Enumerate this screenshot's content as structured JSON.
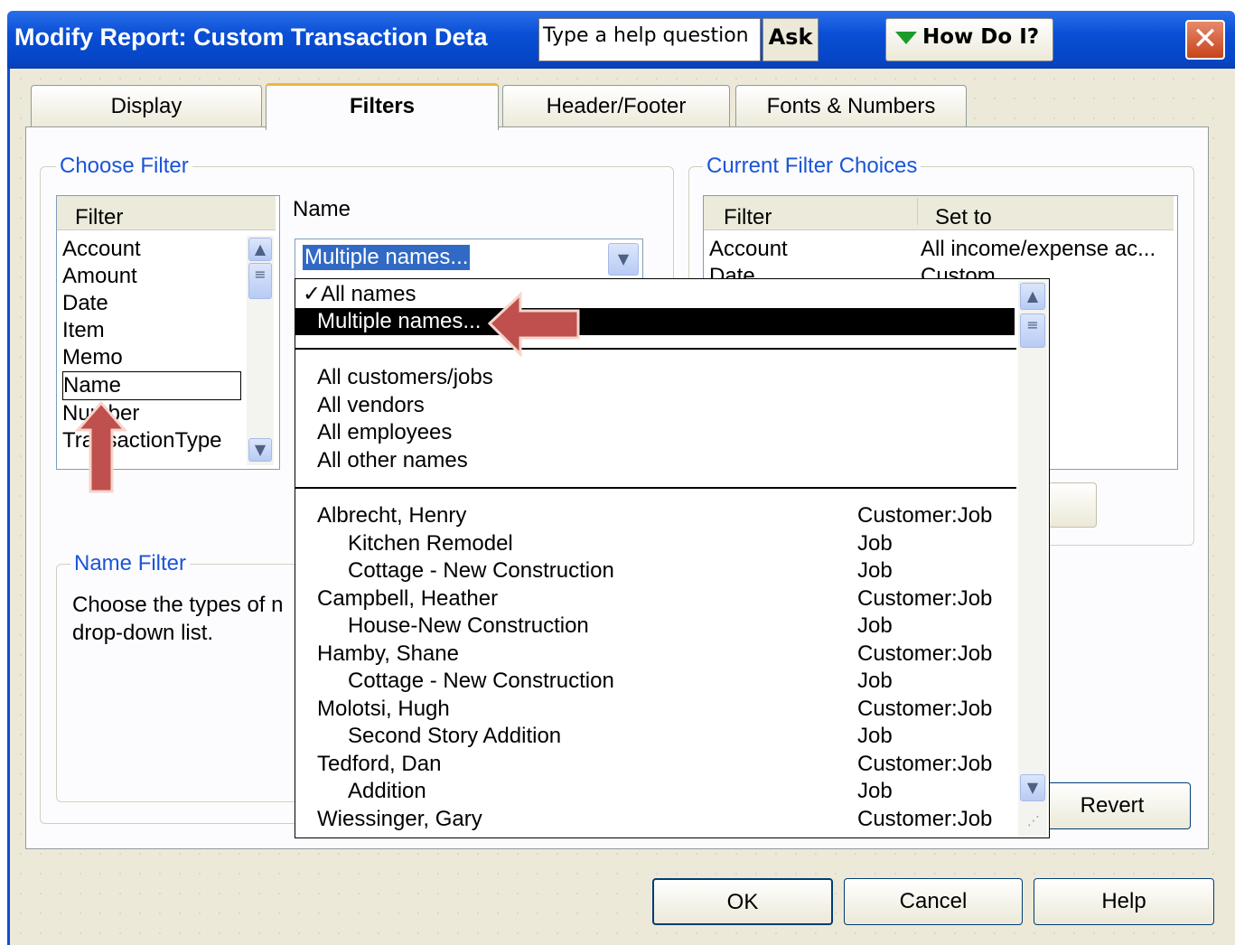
{
  "window": {
    "title": "Modify Report: Custom Transaction Deta",
    "help_placeholder": "Type a help question",
    "ask_label": "Ask",
    "how_do_i_label": "How Do I?",
    "close_glyph": "✕"
  },
  "tabs": [
    {
      "label": "Display",
      "active": false
    },
    {
      "label": "Filters",
      "active": true
    },
    {
      "label": "Header/Footer",
      "active": false
    },
    {
      "label": "Fonts & Numbers",
      "active": false
    }
  ],
  "choose_filter": {
    "title": "Choose Filter",
    "list_header": "Filter",
    "items": [
      "Account",
      "Amount",
      "Date",
      "Item",
      "Memo",
      "Name",
      "Number",
      "TransactionType"
    ],
    "selected": "Name",
    "field_label": "Name",
    "combo_value": "Multiple names..."
  },
  "current_filters": {
    "title": "Current Filter Choices",
    "col_filter": "Filter",
    "col_set_to": "Set to",
    "rows": [
      {
        "filter": "Account",
        "set_to": "All income/expense ac..."
      },
      {
        "filter": "Date",
        "set_to": "Custom"
      }
    ]
  },
  "name_filter": {
    "title": "Name Filter",
    "text_line1": "Choose the types of n",
    "text_line2": "drop-down list."
  },
  "dropdown": {
    "top_items": [
      {
        "label": "All names",
        "checked": true,
        "check_glyph": "✓"
      },
      {
        "label": "Multiple names...",
        "highlighted": true
      }
    ],
    "groups": [
      "All customers/jobs",
      "All vendors",
      "All employees",
      "All other names"
    ],
    "names": [
      {
        "name": "Albrecht, Henry",
        "type": "Customer:Job"
      },
      {
        "name": "Kitchen Remodel",
        "type": "Job"
      },
      {
        "name": "Cottage - New Construction",
        "type": "Job"
      },
      {
        "name": "Campbell, Heather",
        "type": "Customer:Job"
      },
      {
        "name": "House-New Construction",
        "type": "Job"
      },
      {
        "name": "Hamby, Shane",
        "type": "Customer:Job"
      },
      {
        "name": "Cottage - New Construction",
        "type": "Job"
      },
      {
        "name": "Molotsi, Hugh",
        "type": "Customer:Job"
      },
      {
        "name": "Second Story Addition",
        "type": "Job"
      },
      {
        "name": "Tedford, Dan",
        "type": "Customer:Job"
      },
      {
        "name": "Addition",
        "type": "Job"
      },
      {
        "name": "Wiessinger, Gary",
        "type": "Customer:Job"
      }
    ]
  },
  "buttons": {
    "revert": "Revert",
    "ok": "OK",
    "cancel": "Cancel",
    "help": "Help"
  },
  "colors": {
    "title_bar": "#0a4fd6",
    "group_title": "#1a55d6",
    "annotation_arrow": "#c0504d"
  }
}
